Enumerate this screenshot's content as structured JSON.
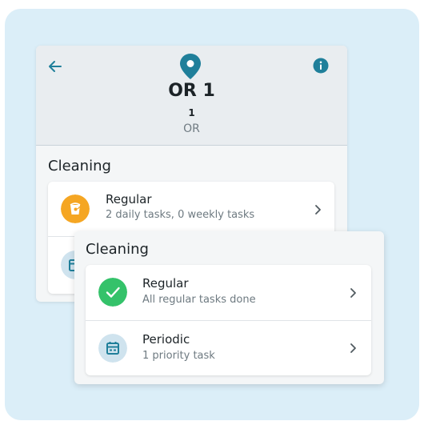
{
  "room": {
    "title": "OR 1",
    "number": "1",
    "type": "OR"
  },
  "back_card": {
    "section_title": "Cleaning",
    "items": [
      {
        "title": "Regular",
        "subtitle": "2 daily tasks, 0 weekly tasks",
        "icon": "cleaning-bucket-icon",
        "color": "#f5a623"
      },
      {
        "title": "Periodic",
        "subtitle": "",
        "icon": "calendar-icon",
        "color": "#cfe3ee"
      }
    ]
  },
  "front_card": {
    "section_title": "Cleaning",
    "items": [
      {
        "title": "Regular",
        "subtitle": "All regular tasks done",
        "icon": "check-icon",
        "color": "#34c26a"
      },
      {
        "title": "Periodic",
        "subtitle": "1 priority task",
        "icon": "calendar-icon",
        "color": "#cfe3ee"
      }
    ]
  },
  "colors": {
    "accent": "#1f7f9a",
    "background": "#dbeef8"
  }
}
